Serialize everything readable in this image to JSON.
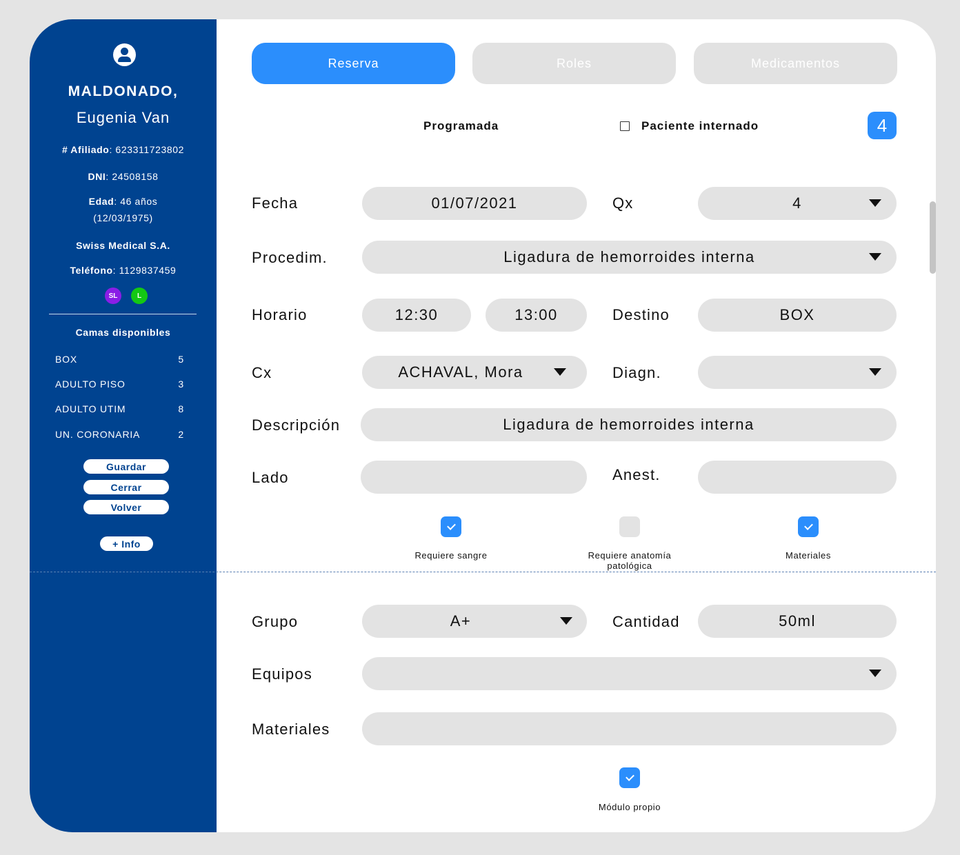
{
  "patient": {
    "surname": "MALDONADO,",
    "given_name": "Eugenia Van",
    "afiliado_label": "# Afiliado",
    "afiliado_value": ": 623311723802",
    "dni_label": "DNI",
    "dni_value": ": 24508158",
    "edad_label": "Edad",
    "edad_value": ": 46 años",
    "birthdate": "(12/03/1975)",
    "insurer": "Swiss Medical S.A.",
    "telefono_label": "Teléfono",
    "telefono_value": ": 1129837459",
    "badges": [
      {
        "text": "SL",
        "color": "#8a1ee6"
      },
      {
        "text": "L",
        "color": "#14c814"
      }
    ]
  },
  "beds": {
    "title": "Camas disponibles",
    "rows": [
      {
        "name": "BOX",
        "count": "5"
      },
      {
        "name": "ADULTO PISO",
        "count": "3"
      },
      {
        "name": "ADULTO UTIM",
        "count": "8"
      },
      {
        "name": "UN. CORONARIA",
        "count": "2"
      }
    ]
  },
  "sidebar_buttons": {
    "save": "Guardar",
    "close": "Cerrar",
    "back": "Volver",
    "more_info": "+ Info"
  },
  "tabs": [
    {
      "label": "Reserva",
      "active": true
    },
    {
      "label": "Roles",
      "active": false
    },
    {
      "label": "Medicamentos",
      "active": false
    }
  ],
  "header": {
    "programada": "Programada",
    "paciente_internado": "Paciente internado",
    "paciente_internado_checked": false,
    "count": "4"
  },
  "form": {
    "fecha_label": "Fecha",
    "fecha_value": "01/07/2021",
    "qx_label": "Qx",
    "qx_value": "4",
    "procedim_label": "Procedim.",
    "procedim_value": "Ligadura de hemorroides interna",
    "horario_label": "Horario",
    "horario_start": "12:30",
    "horario_end": "13:00",
    "destino_label": "Destino",
    "destino_value": "BOX",
    "cx_label": "Cx",
    "cx_value": "ACHAVAL, Mora",
    "diagn_label": "Diagn.",
    "diagn_value": "",
    "descripcion_label": "Descripción",
    "descripcion_value": "Ligadura de hemorroides interna",
    "lado_label": "Lado",
    "lado_value": "",
    "anest_label": "Anest.",
    "anest_value": ""
  },
  "checks": [
    {
      "label": "Requiere sangre",
      "checked": true
    },
    {
      "label": "Requiere anatomía patológica",
      "checked": false
    },
    {
      "label": "Materiales",
      "checked": true
    }
  ],
  "blood": {
    "grupo_label": "Grupo",
    "grupo_value": "A+",
    "cantidad_label": "Cantidad",
    "cantidad_value": "50ml",
    "equipos_label": "Equipos",
    "equipos_value": "",
    "materiales_label": "Materiales",
    "materiales_value": "",
    "modulo_propio_label": "Módulo propio",
    "modulo_propio_checked": true
  },
  "colors": {
    "sidebar": "#004390",
    "accent": "#2b8efc",
    "field": "#e3e3e3"
  }
}
